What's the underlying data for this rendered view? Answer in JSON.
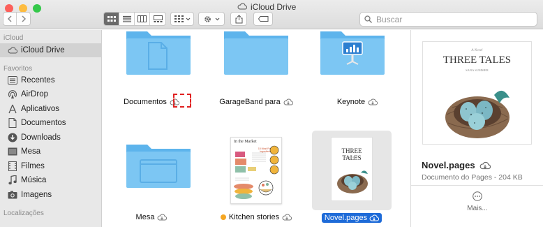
{
  "window": {
    "title": "iCloud Drive",
    "traffic_lights": {
      "close": "#fc605b",
      "minimize": "#fdbc40",
      "zoom": "#34c84a"
    }
  },
  "toolbar": {
    "search_placeholder": "Buscar",
    "view_modes": [
      "icons",
      "list",
      "columns",
      "gallery"
    ],
    "active_view": "icons"
  },
  "sidebar": {
    "sections": [
      {
        "heading": "iCloud",
        "items": [
          {
            "label": "iCloud Drive",
            "icon": "cloud-icon",
            "selected": true
          }
        ]
      },
      {
        "heading": "Favoritos",
        "items": [
          {
            "label": "Recentes",
            "icon": "recents-icon"
          },
          {
            "label": "AirDrop",
            "icon": "airdrop-icon"
          },
          {
            "label": "Aplicativos",
            "icon": "applications-icon"
          },
          {
            "label": "Documentos",
            "icon": "document-icon"
          },
          {
            "label": "Downloads",
            "icon": "downloads-icon"
          },
          {
            "label": "Mesa",
            "icon": "desktop-icon"
          },
          {
            "label": "Filmes",
            "icon": "movies-icon"
          },
          {
            "label": "Música",
            "icon": "music-icon"
          },
          {
            "label": "Imagens",
            "icon": "pictures-icon"
          }
        ]
      },
      {
        "heading": "Localizações",
        "items": []
      }
    ]
  },
  "files": [
    {
      "name": "Documentos",
      "kind": "folder",
      "glyph": "document",
      "cloud": true,
      "annotated": true
    },
    {
      "name": "GarageBand para",
      "kind": "folder",
      "glyph": "none",
      "cloud": true
    },
    {
      "name": "Keynote",
      "kind": "folder",
      "glyph": "keynote",
      "cloud": true
    },
    {
      "name": "Mesa",
      "kind": "folder",
      "glyph": "desktop",
      "cloud": true
    },
    {
      "name": "Kitchen stories",
      "kind": "document",
      "tag_color": "#f5a623",
      "cloud": true,
      "thumb": {
        "heading": "In the Market",
        "subheading": "15 Most Fresh Ingredients"
      }
    },
    {
      "name": "Novel.pages",
      "kind": "document",
      "cloud": true,
      "selected": true,
      "thumb": {
        "title": "THREE TALES",
        "author": "SANA SUMMER"
      }
    }
  ],
  "preview": {
    "cover_kicker": "A Novel",
    "cover_title": "THREE TALES",
    "cover_author": "SANA SUMMER",
    "name": "Novel.pages",
    "info": "Documento do Pages - 204 KB",
    "more_label": "Mais..."
  },
  "colors": {
    "folder": "#7cc6f3",
    "folder_back": "#5db4ec",
    "selection": "#1e6bd8",
    "annotation": "#e02020"
  }
}
